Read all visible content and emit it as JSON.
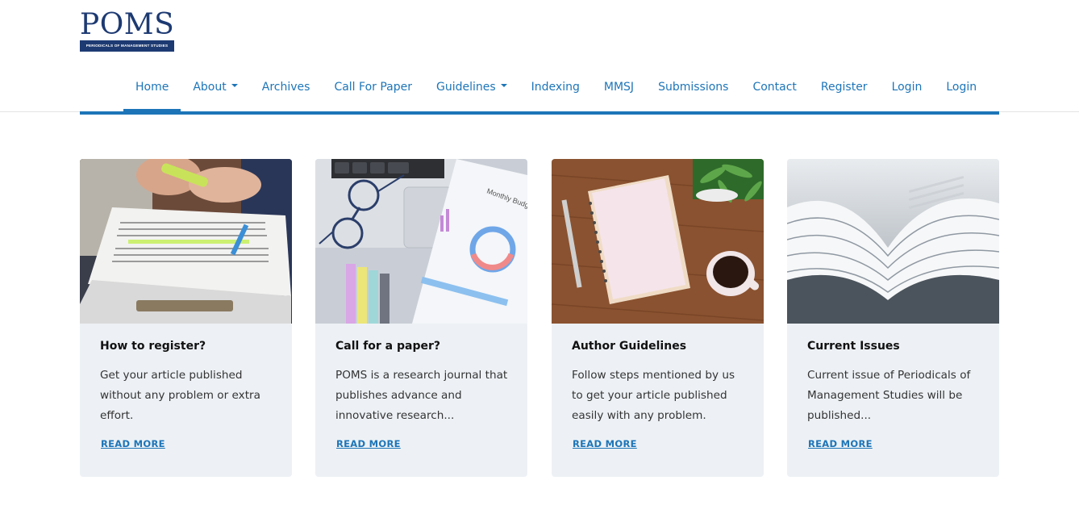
{
  "brand": {
    "name": "POMS",
    "tagline": "PERIODICALS OF MANAGEMENT STUDIES",
    "color": "#1d3a72"
  },
  "accent_color": "#1d75b8",
  "nav": {
    "items": [
      {
        "label": "Home",
        "active": true,
        "dropdown": false
      },
      {
        "label": "About",
        "active": false,
        "dropdown": true
      },
      {
        "label": "Archives",
        "active": false,
        "dropdown": false
      },
      {
        "label": "Call For Paper",
        "active": false,
        "dropdown": false
      },
      {
        "label": "Guidelines",
        "active": false,
        "dropdown": true
      },
      {
        "label": "Indexing",
        "active": false,
        "dropdown": false
      },
      {
        "label": "MMSJ",
        "active": false,
        "dropdown": false
      },
      {
        "label": "Submissions",
        "active": false,
        "dropdown": false
      },
      {
        "label": "Contact",
        "active": false,
        "dropdown": false
      },
      {
        "label": "Register",
        "active": false,
        "dropdown": false
      },
      {
        "label": "Login",
        "active": false,
        "dropdown": false
      },
      {
        "label": "Login",
        "active": false,
        "dropdown": false
      }
    ]
  },
  "cards": [
    {
      "image": "highlighting-book-photo",
      "title": "How to register?",
      "text": "Get your article published without any problem or extra effort.",
      "link": "READ MORE"
    },
    {
      "image": "desk-laptop-glasses-photo",
      "title": "Call for a paper?",
      "text": "POMS is a research journal that publishes advance and innovative research...",
      "link": "READ MORE",
      "image_text": "Monthly Budg"
    },
    {
      "image": "notebook-coffee-photo",
      "title": "Author Guidelines",
      "text": "Follow steps mentioned by us to get your article published easily with any problem.",
      "link": "READ MORE"
    },
    {
      "image": "open-magazines-photo",
      "title": "Current Issues",
      "text": "Current issue of Periodicals of Management Studies will be published...",
      "link": "READ MORE"
    }
  ]
}
